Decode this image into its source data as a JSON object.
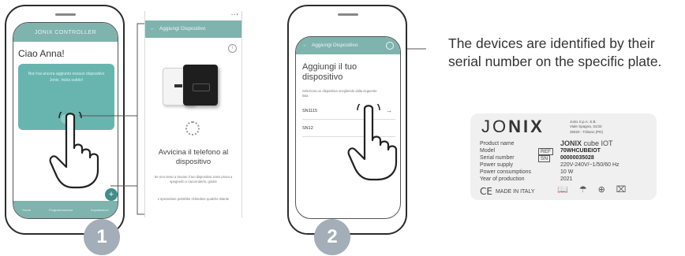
{
  "step1": {
    "badge": "1",
    "app_header": "JONIX CONTROLLER",
    "greeting": "Ciao Anna!",
    "card_text": "Non hai ancora aggiunto nessun dispositivo Jonix. Inizia subito!",
    "fab_label": "+",
    "nav": [
      "Home",
      "Programmazione",
      "Impostazioni"
    ],
    "detail": {
      "status": "▪ ▪ ▾",
      "header": "Aggiungi Dispositivo",
      "info_icon": "i",
      "title": "Avvicina il telefono al dispositivo",
      "sub1": "Se non riesci a trovare il tuo dispositivo Jonix prova a spegnerlo e riaccenderlo, grazie",
      "sub2": "L'operazione potrebbe richiedere qualche istante"
    }
  },
  "step2": {
    "badge": "2",
    "header": "Aggiungi Dispositivo",
    "title": "Aggiungi il tuo dispositivo",
    "hint": "Seleziona un dispositivo scegliendo dalla seguente lista",
    "rows": [
      {
        "label": "SN1115",
        "arrow": "→"
      },
      {
        "label": "SN12",
        "arrow": ""
      }
    ]
  },
  "callout": {
    "text": "The devices are identified by their serial number on the specific plate."
  },
  "plate": {
    "brand_prefix": "JO",
    "brand_suffix": "NIX",
    "address": [
      "Jonix S.p.A. S.B.",
      "Viale Spagna, 31/33",
      "35020 - Tribano (PD)"
    ],
    "labels": [
      "Product name",
      "Model",
      "Serial number",
      "Power supply",
      "Power consumptions",
      "Year of production"
    ],
    "ref_label": "REF",
    "sn_label": "SN",
    "product_brand": "JONIX",
    "product_suffix": " cube IOT",
    "model": "70WHCUBEIOT",
    "serial": "00000035028",
    "power_supply": "220V-240V/~1/50/60 Hz",
    "power_consumption": "10 W",
    "year": "2021",
    "ce": "CE",
    "made_in": "MADE IN ITALY",
    "icons": [
      "manual-icon",
      "keep-dry-icon",
      "protection-icon",
      "weee-bin-icon"
    ]
  },
  "colors": {
    "teal_header": "#7fb3ae",
    "teal_card": "#68b5b0",
    "badge": "#a3aeb8",
    "plate_bg": "#f0f0f0"
  }
}
